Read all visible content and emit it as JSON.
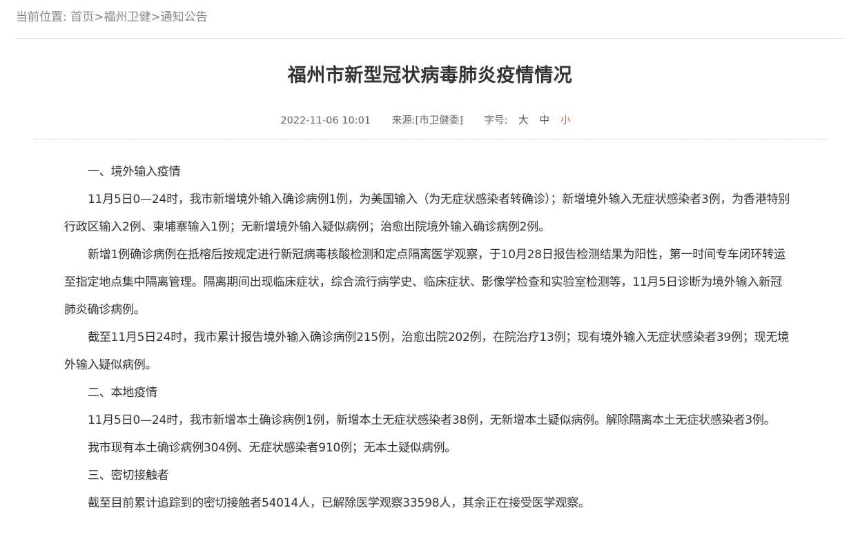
{
  "breadcrumb": {
    "prefix": "当前位置:",
    "items": [
      "首页",
      "福州卫健",
      "通知公告"
    ],
    "separator": ">"
  },
  "article": {
    "title": "福州市新型冠状病毒肺炎疫情情况",
    "date": "2022-11-06 10:01",
    "source_label": "来源:",
    "source": "[市卫健委]",
    "font_size_label": "字号:",
    "font_sizes": [
      "大",
      "中",
      "小"
    ],
    "active_font_size": "小",
    "accent_color": "#e05a2b",
    "paragraphs": [
      "一、境外输入疫情",
      "11月5日0—24时，我市新增境外输入确诊病例1例，为美国输入（为无症状感染者转确诊）；新增境外输入无症状感染者3例，为香港特别行政区输入2例、柬埔寨输入1例；无新增境外输入疑似病例；治愈出院境外输入确诊病例2例。",
      "新增1例确诊病例在抵榕后按规定进行新冠病毒核酸检测和定点隔离医学观察，于10月28日报告检测结果为阳性，第一时间专车闭环转运至指定地点集中隔离管理。隔离期间出现临床症状，综合流行病学史、临床症状、影像学检查和实验室检测等，11月5日诊断为境外输入新冠肺炎确诊病例。",
      "截至11月5日24时，我市累计报告境外输入确诊病例215例，治愈出院202例，在院治疗13例；现有境外输入无症状感染者39例；现无境外输入疑似病例。",
      "二、本地疫情",
      "11月5日0—24时，我市新增本土确诊病例1例，新增本土无症状感染者38例，无新增本土疑似病例。解除隔离本土无症状感染者3例。",
      "我市现有本土确诊病例304例、无症状感染者910例；无本土疑似病例。",
      "三、密切接触者",
      "截至目前累计追踪到的密切接触者54014人，已解除医学观察33598人，其余正在接受医学观察。"
    ]
  }
}
